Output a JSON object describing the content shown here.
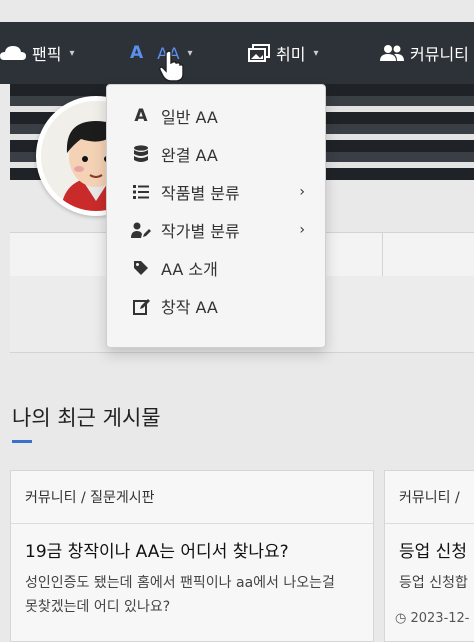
{
  "nav": {
    "items": [
      {
        "label": "팬픽",
        "icon": "cloud-icon"
      },
      {
        "label": "AA",
        "icon": "font-a-icon"
      },
      {
        "label": "취미",
        "icon": "images-icon"
      },
      {
        "label": "커뮤니티",
        "icon": "users-icon"
      }
    ],
    "caret": "▾",
    "aa_color": "#5b8ff0"
  },
  "dropdown": {
    "items": [
      {
        "label": "일반 AA",
        "icon": "font-icon"
      },
      {
        "label": "완결 AA",
        "icon": "database-icon"
      },
      {
        "label": "작품별 분류",
        "icon": "list-icon",
        "submenu": "›"
      },
      {
        "label": "작가별 분류",
        "icon": "user-edit-icon",
        "submenu": "›"
      },
      {
        "label": "AA 소개",
        "icon": "tag-icon"
      },
      {
        "label": "창작 AA",
        "icon": "edit-icon"
      }
    ]
  },
  "section": {
    "title": "나의 최근 게시물",
    "accent": "#3c6fcf"
  },
  "posts": [
    {
      "category": "커뮤니티 / 질문게시판",
      "title": "19금 창작이나 AA는 어디서 찾나요?",
      "snippet": "성인인증도 됐는데 홈에서 팬픽이나 aa에서 나오는걸 못찾겠는데 어디 있나요?"
    },
    {
      "category": "커뮤니티 /",
      "title": "등업 신청",
      "snippet": "등업 신청합",
      "time": "2023-12-"
    }
  ]
}
